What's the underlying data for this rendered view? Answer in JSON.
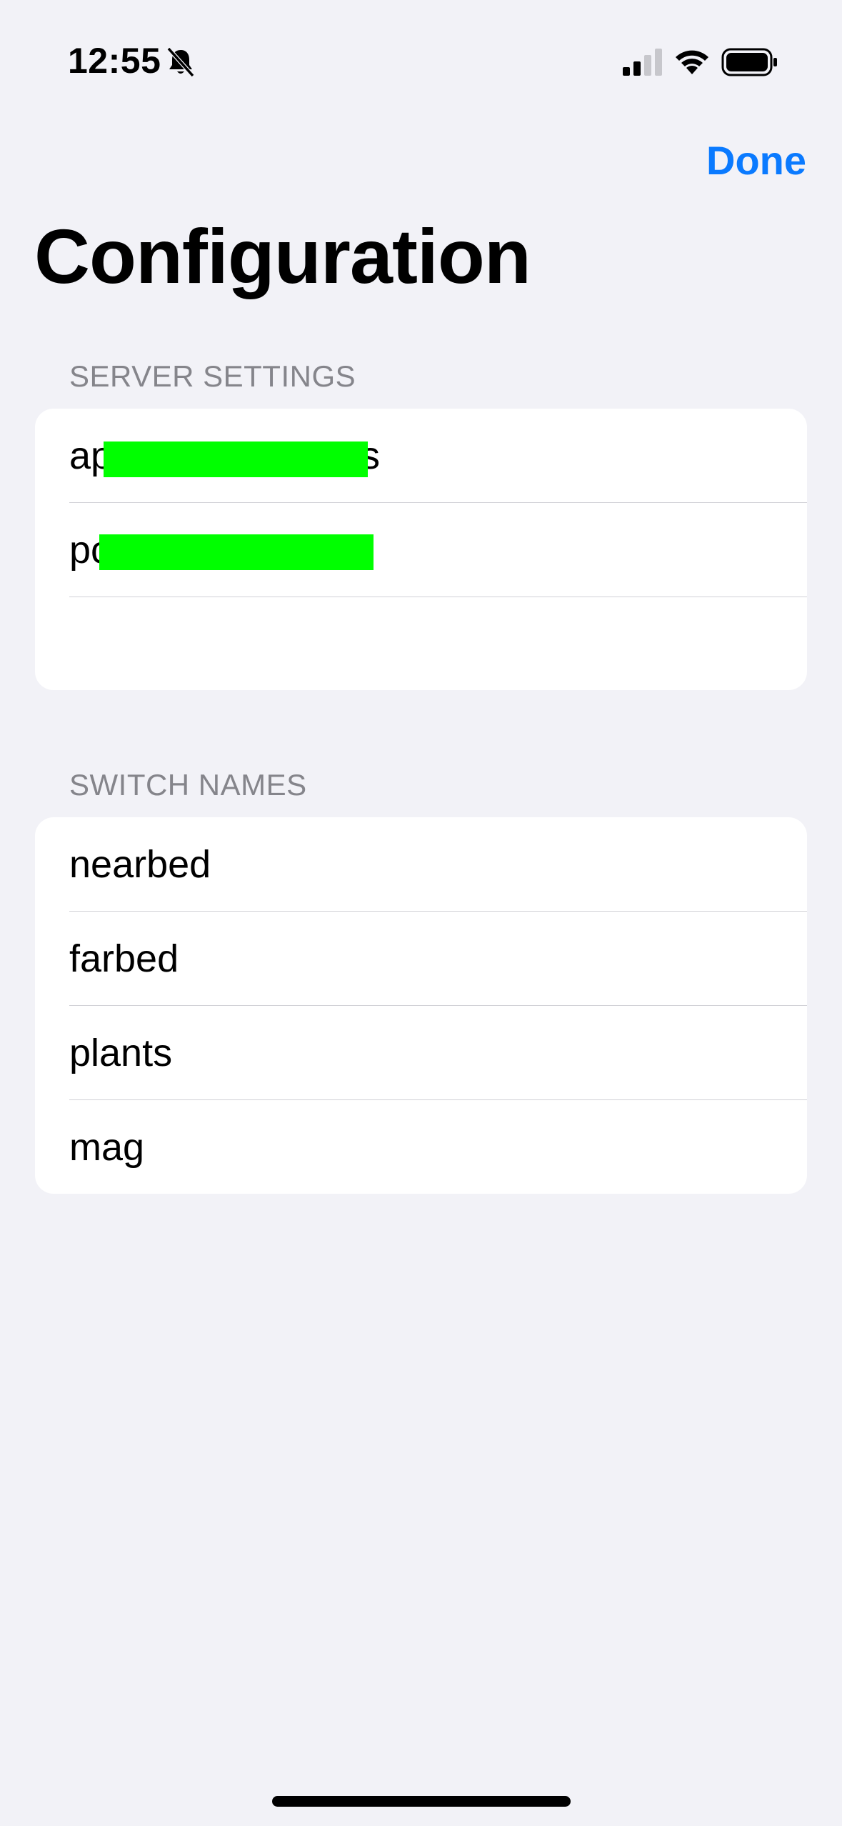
{
  "status_bar": {
    "time": "12:55",
    "icons": [
      "bell-slash-icon",
      "cellular-signal-icon",
      "wifi-icon",
      "battery-icon"
    ]
  },
  "nav": {
    "done_label": "Done",
    "accent_color": "#0a7aff"
  },
  "page_title": "Configuration",
  "server_settings": {
    "header": "SERVER SETTINGS",
    "rows": [
      {
        "prefix": "ap",
        "suffix": "s"
      },
      {
        "prefix": "pc",
        "suffix": ""
      },
      {
        "prefix": "",
        "suffix": ""
      }
    ]
  },
  "switch_names": {
    "header": "SWITCH NAMES",
    "items": [
      "nearbed",
      "farbed",
      "plants",
      "mag"
    ]
  }
}
